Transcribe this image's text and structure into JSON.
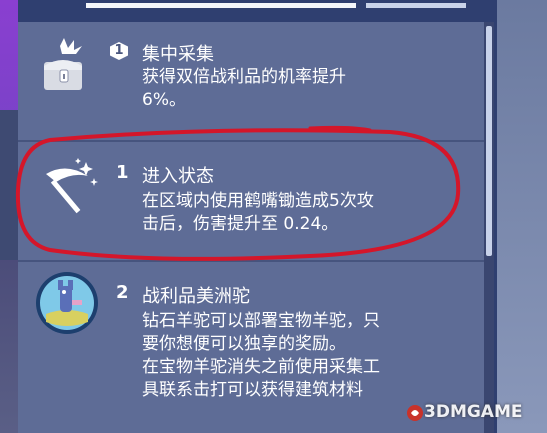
{
  "perks": [
    {
      "id": "collect",
      "level": "1",
      "title": "集中采集",
      "desc_lines": [
        "获得双倍战利品的机率提升",
        "6%。"
      ],
      "icon": "chest-burst-icon"
    },
    {
      "id": "state",
      "level": "1",
      "title": "进入状态",
      "desc_lines": [
        "在区域内使用鹤嘴锄造成5次攻",
        "击后，伤害提升至 0.24。"
      ],
      "icon": "pickaxe-sparkle-icon"
    },
    {
      "id": "llama",
      "level": "2",
      "title": "战利品美洲驼",
      "desc_lines": [
        "钻石羊驼可以部署宝物羊驼，只",
        "要你想便可以独享的奖励。",
        "在宝物羊驼消失之前使用采集工",
        "具联系击打可以获得建筑材料"
      ],
      "icon": "llama-icon"
    }
  ],
  "watermark": "3DMGAME",
  "colors": {
    "panel": "#5e6c96",
    "text": "#ffffff",
    "highlight": "#d4162a"
  }
}
